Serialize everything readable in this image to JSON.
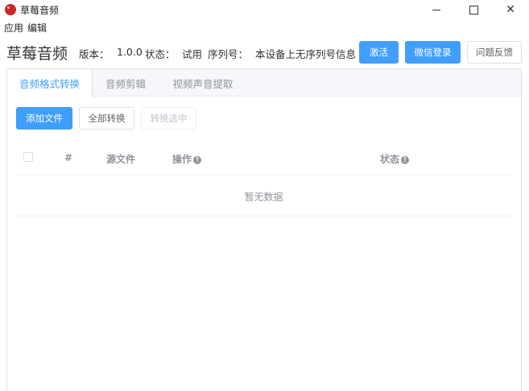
{
  "window": {
    "title": "草莓音频",
    "minimize_glyph": "minimize-icon",
    "maximize_glyph": "maximize-icon",
    "close_glyph": "✕"
  },
  "menu": {
    "items": [
      "应用",
      "编辑"
    ]
  },
  "header": {
    "brand": "草莓音频",
    "version_label": "版本：",
    "version_value": "1.0.0",
    "status_label": "状态：",
    "status_value": "试用",
    "serial_label": "序列号：",
    "serial_value": "本设备上无序列号信息",
    "activate_button": "激活",
    "wechat_login_button": "微信登录",
    "feedback_button": "问题反馈"
  },
  "tabs": [
    {
      "label": "音频格式转换",
      "active": true
    },
    {
      "label": "音频剪辑",
      "active": false
    },
    {
      "label": "视频声音提取",
      "active": false
    }
  ],
  "toolbar": {
    "add_file": "添加文件",
    "convert_all": "全部转换",
    "convert_selected": "转换选中"
  },
  "table": {
    "columns": [
      "#",
      "源文件",
      "操作",
      "状态"
    ],
    "info_icon_glyph": "!",
    "empty_text": "暂无数据"
  },
  "colors": {
    "primary": "#409eff",
    "text": "#303133",
    "muted": "#909399",
    "logo": "#c8262b"
  }
}
